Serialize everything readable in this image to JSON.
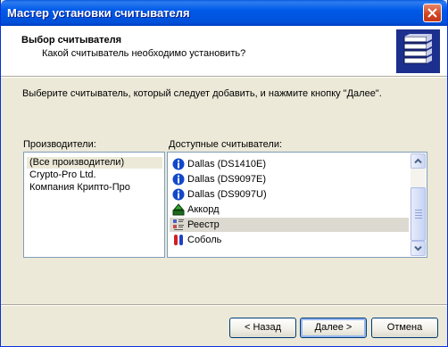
{
  "window": {
    "title": "Мастер установки считывателя"
  },
  "header": {
    "title": "Выбор считывателя",
    "subtitle": "Какой считыватель необходимо установить?"
  },
  "instruction": "Выберите считыватель, который следует добавить, и нажмите кнопку \"Далее\".",
  "manufacturers": {
    "label": "Производители:",
    "items": [
      "(Все производители)",
      "Crypto-Pro Ltd.",
      "Компания Крипто-Про"
    ],
    "selected": "(Все производители)"
  },
  "readers": {
    "label": "Доступные считыватели:",
    "items": [
      {
        "label": "Dallas (DS1410E)",
        "icon": "info-icon"
      },
      {
        "label": "Dallas (DS9097E)",
        "icon": "info-icon"
      },
      {
        "label": "Dallas (DS9097U)",
        "icon": "info-icon"
      },
      {
        "label": "Аккорд",
        "icon": "accord-reader-icon"
      },
      {
        "label": "Реестр",
        "icon": "registry-icon"
      },
      {
        "label": "Соболь",
        "icon": "sobol-icon"
      }
    ],
    "selected": "Реестр"
  },
  "buttons": {
    "back": "< Назад",
    "next": "Далее >",
    "cancel": "Отмена"
  },
  "colors": {
    "title_bar": "#0054e3",
    "dialog_face": "#ece9d8",
    "close_button": "#d2431e",
    "info_icon": "#1248c9"
  }
}
